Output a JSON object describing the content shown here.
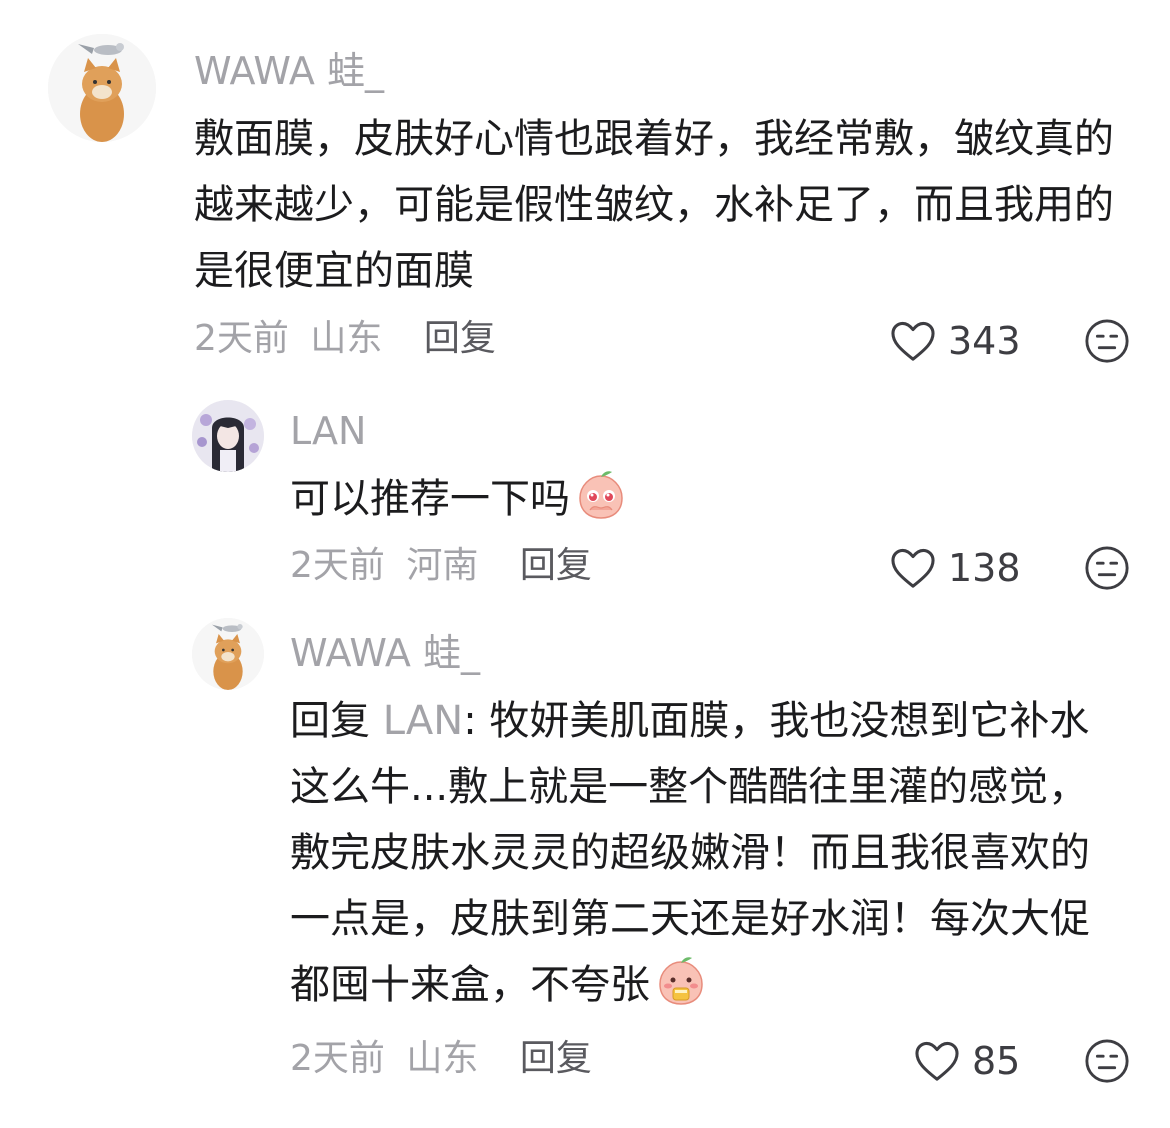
{
  "comments": [
    {
      "username": "WAWA 蛙_",
      "text": "敷面膜，皮肤好心情也跟着好，我经常敷，皱纹真的越来越少，可能是假性皱纹，水补足了，而且我用的是很便宜的面膜",
      "time": "2天前",
      "location": "山东",
      "reply_label": "回复",
      "likes": "343",
      "avatar_icon": "cat-with-bird-avatar"
    },
    {
      "username": "LAN",
      "text": "可以推荐一下吗",
      "emoji": "peach-pleading-emoji",
      "time": "2天前",
      "location": "河南",
      "reply_label": "回复",
      "likes": "138",
      "avatar_icon": "anime-girl-avatar"
    },
    {
      "username": "WAWA 蛙_",
      "reply_prefix": "回复",
      "mention": "LAN",
      "text": ": 牧妍美肌面膜，我也没想到它补水这么牛...敷上就是一整个酷酷往里灌的感觉，敷完皮肤水灵灵的超级嫩滑！而且我很喜欢的一点是，皮肤到第二天还是好水润！每次大促都囤十来盒，不夸张",
      "emoji": "peach-eating-emoji",
      "time": "2天前",
      "location": "山东",
      "reply_label": "回复",
      "likes": "85",
      "avatar_icon": "cat-with-bird-avatar"
    }
  ],
  "icons": {
    "like": "heart-outline-icon",
    "dislike": "meh-face-icon"
  },
  "colors": {
    "meta": "#a3a3a8",
    "text": "#1c1c1e",
    "emoji_peach": "#f7b2a6"
  }
}
